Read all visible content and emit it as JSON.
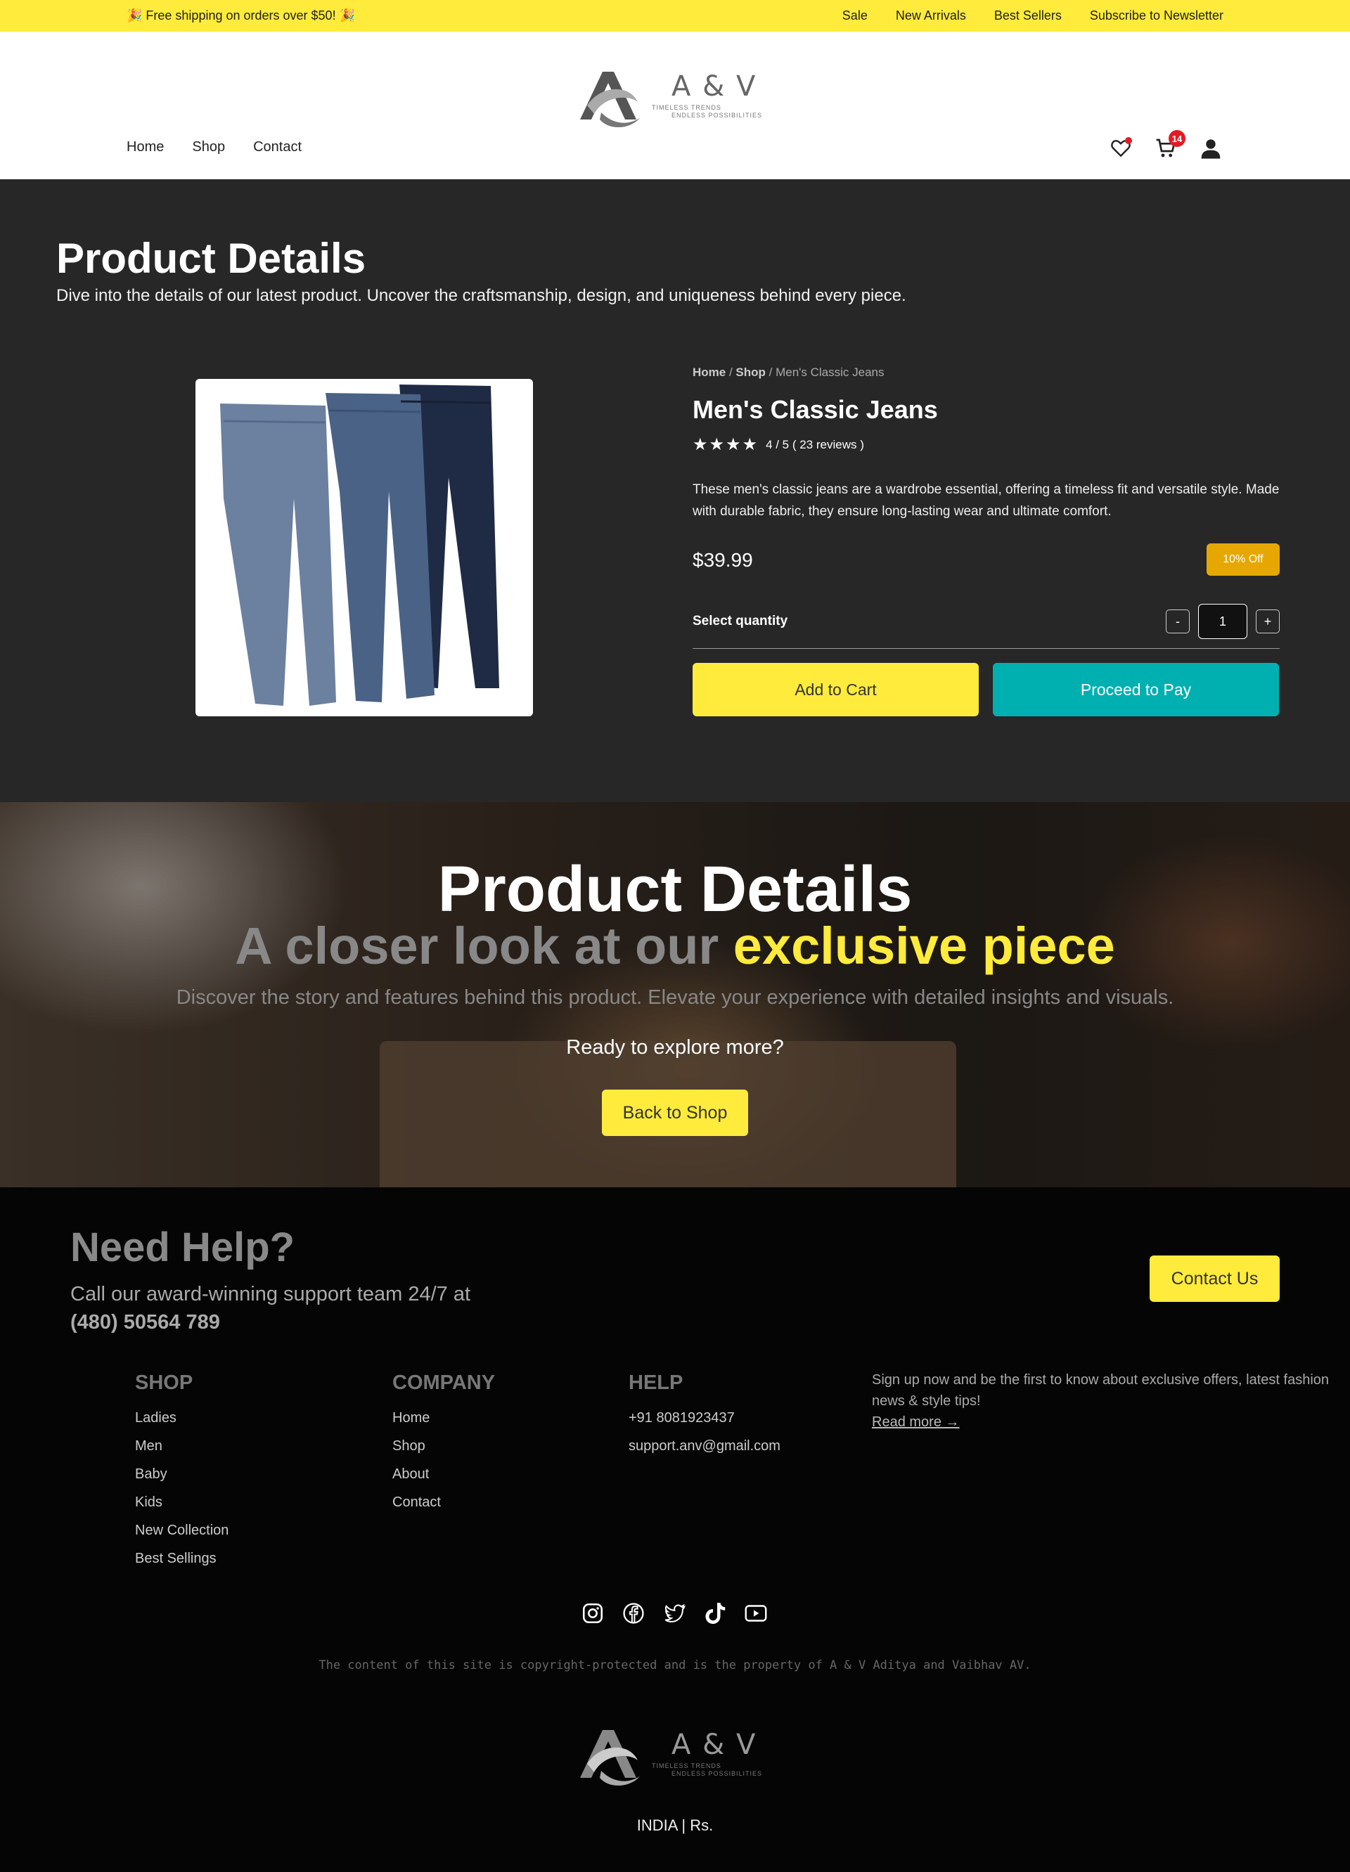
{
  "topbar": {
    "promo": "🎉 Free shipping on orders over $50! 🎉",
    "links": [
      "Sale",
      "New Arrivals",
      "Best Sellers",
      "Subscribe to Newsletter"
    ]
  },
  "header": {
    "logo": {
      "brand": "A & V",
      "tagline_1": "TIMELESS TRENDS",
      "tagline_2": "ENDLESS POSSIBILITIES"
    },
    "nav": [
      "Home",
      "Shop",
      "Contact"
    ],
    "icons": [
      "heart-icon",
      "cart-icon",
      "user-icon"
    ],
    "cart_count": "14"
  },
  "product_section": {
    "title": "Product Details",
    "subtitle": "Dive into the details of our latest product. Uncover the craftsmanship, design, and uniqueness behind every piece.",
    "breadcrumb": {
      "home": "Home",
      "sep": " / ",
      "shop": "Shop",
      "current": "Men's Classic Jeans"
    },
    "name": "Men's Classic Jeans",
    "stars": "★★★★",
    "rating_text": "4 / 5 ( 23 reviews )",
    "description": "These men's classic jeans are a wardrobe essential, offering a timeless fit and versatile style. Made with durable fabric, they ensure long-lasting wear and ultimate comfort.",
    "price": "$39.99",
    "discount": "10% Off",
    "quantity_label": "Select quantity",
    "quantity": "1",
    "minus": "-",
    "plus": "+",
    "add_to_cart": "Add to Cart",
    "proceed_to_pay": "Proceed to Pay"
  },
  "hero": {
    "title": "Product Details",
    "line2_muted": "A closer look at our ",
    "line2_accent": "exclusive piece",
    "description": "Discover the story and features behind this product. Elevate your experience with detailed insights and visuals.",
    "prompt": "Ready to explore more?",
    "button": "Back to Shop"
  },
  "footer": {
    "help_title": "Need Help?",
    "help_text": "Call our award-winning support team 24/7 at",
    "help_phone": "(480) 50564 789",
    "contact_button": "Contact Us",
    "columns": [
      {
        "title": "SHOP",
        "items": [
          "Ladies",
          "Men",
          "Baby",
          "Kids",
          "New Collection",
          "Best Sellings"
        ]
      },
      {
        "title": "COMPANY",
        "items": [
          "Home",
          "Shop",
          "About",
          "Contact"
        ]
      },
      {
        "title": "HELP",
        "items": [
          "+91 8081923437",
          "support.anv@gmail.com"
        ]
      }
    ],
    "newsletter_text": "Sign up now and be the first to know about exclusive offers, latest fashion news & style tips!",
    "read_more": "Read more →",
    "social": [
      "instagram-icon",
      "facebook-icon",
      "twitter-icon",
      "tiktok-icon",
      "youtube-icon"
    ],
    "copyright": "The content of this site is copyright-protected and is the property of A & V Aditya and Vaibhav AV.",
    "logo": {
      "brand": "A & V",
      "tagline_1": "TIMELESS TRENDS",
      "tagline_2": "ENDLESS POSSIBILITIES"
    },
    "locale": "INDIA | Rs."
  },
  "colors": {
    "accent_yellow": "#ffeb3b",
    "accent_teal": "#00b0b0",
    "discount_badge": "#e6a800",
    "badge_red": "#e31b23",
    "product_bg": "#272727",
    "footer_bg": "#050505"
  }
}
